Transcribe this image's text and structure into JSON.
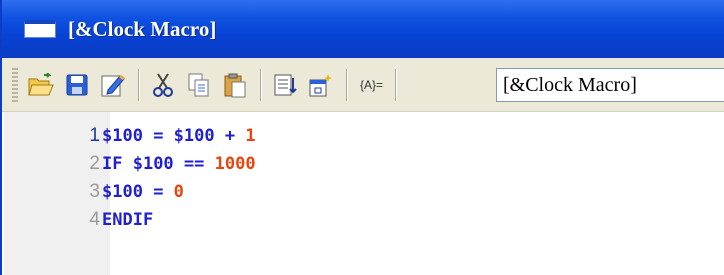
{
  "window": {
    "title": "[&Clock Macro]"
  },
  "toolbar": {
    "buttons": [
      "open-icon",
      "save-icon",
      "edit-icon",
      "cut-icon",
      "copy-icon",
      "paste-icon",
      "insert-command-icon",
      "properties-icon"
    ],
    "ab_label": "{A}=",
    "macro_name": "[&Clock Macro]"
  },
  "editor": {
    "lines": [
      {
        "num": "1",
        "tokens": [
          [
            "var",
            "$100"
          ],
          [
            "op",
            " = "
          ],
          [
            "var",
            "$100"
          ],
          [
            "op",
            " + "
          ],
          [
            "num",
            "1"
          ]
        ]
      },
      {
        "num": "2",
        "tokens": [
          [
            "kw",
            "IF "
          ],
          [
            "var",
            "$100"
          ],
          [
            "op",
            " == "
          ],
          [
            "num",
            "1000"
          ]
        ]
      },
      {
        "num": "3",
        "tokens": [
          [
            "var",
            "$100"
          ],
          [
            "op",
            " = "
          ],
          [
            "num",
            "0"
          ]
        ]
      },
      {
        "num": "4",
        "tokens": [
          [
            "kw",
            "ENDIF"
          ]
        ]
      }
    ]
  },
  "colors": {
    "titlebar": "#0843d6",
    "keyword": "#1f1fd2",
    "number": "#e8450f",
    "toolbar_bg": "#ece9d8"
  }
}
